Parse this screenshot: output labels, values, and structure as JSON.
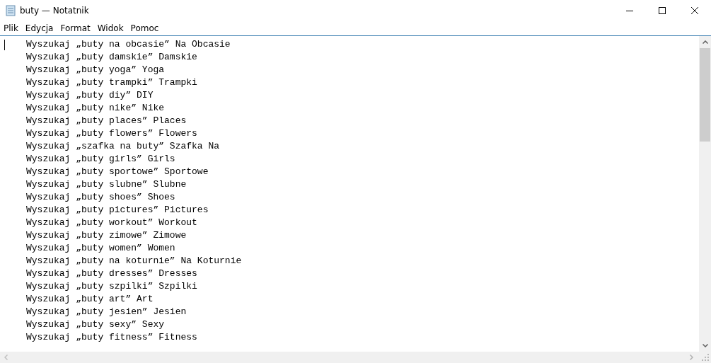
{
  "window": {
    "title": "buty — Notatnik"
  },
  "menu": [
    "Plik",
    "Edycja",
    "Format",
    "Widok",
    "Pomoc"
  ],
  "lines": [
    "Wyszukaj „buty na obcasie” Na Obcasie",
    "Wyszukaj „buty damskie” Damskie",
    "Wyszukaj „buty yoga” Yoga",
    "Wyszukaj „buty trampki” Trampki",
    "Wyszukaj „buty diy” DIY",
    "Wyszukaj „buty nike” Nike",
    "Wyszukaj „buty places” Places",
    "Wyszukaj „buty flowers” Flowers",
    "Wyszukaj „szafka na buty” Szafka Na",
    "Wyszukaj „buty girls” Girls",
    "Wyszukaj „buty sportowe” Sportowe",
    "Wyszukaj „buty slubne” Slubne",
    "Wyszukaj „buty shoes” Shoes",
    "Wyszukaj „buty pictures” Pictures",
    "Wyszukaj „buty workout” Workout",
    "Wyszukaj „buty zimowe” Zimowe",
    "Wyszukaj „buty women” Women",
    "Wyszukaj „buty na koturnie” Na Koturnie",
    "Wyszukaj „buty dresses” Dresses",
    "Wyszukaj „buty szpilki” Szpilki",
    "Wyszukaj „buty art” Art",
    "Wyszukaj „buty jesien” Jesien",
    "Wyszukaj „buty sexy” Sexy",
    "Wyszukaj „buty fitness” Fitness"
  ]
}
